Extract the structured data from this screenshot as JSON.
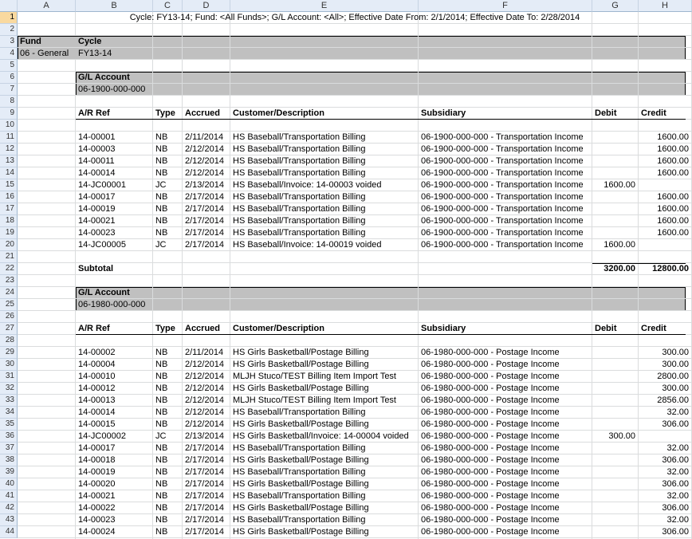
{
  "columns": [
    "A",
    "B",
    "C",
    "D",
    "E",
    "F",
    "G",
    "H"
  ],
  "title": "Cycle: FY13-14; Fund: <All Funds>; G/L Account: <All>; Effective Date From: 2/1/2014; Effective Date To: 2/28/2014",
  "fund_header": {
    "fund_label": "Fund",
    "cycle_label": "Cycle",
    "fund_value": "06 - General",
    "cycle_value": "FY13-14"
  },
  "section1": {
    "gl_label": "G/L Account",
    "gl_value": "06-1900-000-000",
    "headers": {
      "ar": "A/R Ref",
      "type": "Type",
      "accrued": "Accrued",
      "desc": "Customer/Description",
      "sub": "Subsidiary",
      "debit": "Debit",
      "credit": "Credit"
    },
    "rows": [
      {
        "ar": "14-00001",
        "type": "NB",
        "accrued": "2/11/2014",
        "desc": "HS Baseball/Transportation Billing",
        "sub": "06-1900-000-000 - Transportation Income",
        "debit": "",
        "credit": "1600.00"
      },
      {
        "ar": "14-00003",
        "type": "NB",
        "accrued": "2/12/2014",
        "desc": "HS Baseball/Transportation Billing",
        "sub": "06-1900-000-000 - Transportation Income",
        "debit": "",
        "credit": "1600.00"
      },
      {
        "ar": "14-00011",
        "type": "NB",
        "accrued": "2/12/2014",
        "desc": "HS Baseball/Transportation Billing",
        "sub": "06-1900-000-000 - Transportation Income",
        "debit": "",
        "credit": "1600.00"
      },
      {
        "ar": "14-00014",
        "type": "NB",
        "accrued": "2/12/2014",
        "desc": "HS Baseball/Transportation Billing",
        "sub": "06-1900-000-000 - Transportation Income",
        "debit": "",
        "credit": "1600.00"
      },
      {
        "ar": "14-JC00001",
        "type": "JC",
        "accrued": "2/13/2014",
        "desc": "HS Baseball/Invoice: 14-00003 voided",
        "sub": "06-1900-000-000 - Transportation Income",
        "debit": "1600.00",
        "credit": ""
      },
      {
        "ar": "14-00017",
        "type": "NB",
        "accrued": "2/17/2014",
        "desc": "HS Baseball/Transportation Billing",
        "sub": "06-1900-000-000 - Transportation Income",
        "debit": "",
        "credit": "1600.00"
      },
      {
        "ar": "14-00019",
        "type": "NB",
        "accrued": "2/17/2014",
        "desc": "HS Baseball/Transportation Billing",
        "sub": "06-1900-000-000 - Transportation Income",
        "debit": "",
        "credit": "1600.00"
      },
      {
        "ar": "14-00021",
        "type": "NB",
        "accrued": "2/17/2014",
        "desc": "HS Baseball/Transportation Billing",
        "sub": "06-1900-000-000 - Transportation Income",
        "debit": "",
        "credit": "1600.00"
      },
      {
        "ar": "14-00023",
        "type": "NB",
        "accrued": "2/17/2014",
        "desc": "HS Baseball/Transportation Billing",
        "sub": "06-1900-000-000 - Transportation Income",
        "debit": "",
        "credit": "1600.00"
      },
      {
        "ar": "14-JC00005",
        "type": "JC",
        "accrued": "2/17/2014",
        "desc": "HS Baseball/Invoice: 14-00019 voided",
        "sub": "06-1900-000-000 - Transportation Income",
        "debit": "1600.00",
        "credit": ""
      }
    ],
    "subtotal_label": "Subtotal",
    "subtotal_debit": "3200.00",
    "subtotal_credit": "12800.00"
  },
  "section2": {
    "gl_label": "G/L Account",
    "gl_value": "06-1980-000-000",
    "headers": {
      "ar": "A/R Ref",
      "type": "Type",
      "accrued": "Accrued",
      "desc": "Customer/Description",
      "sub": "Subsidiary",
      "debit": "Debit",
      "credit": "Credit"
    },
    "rows": [
      {
        "ar": "14-00002",
        "type": "NB",
        "accrued": "2/11/2014",
        "desc": "HS Girls Basketball/Postage Billing",
        "sub": "06-1980-000-000 - Postage Income",
        "debit": "",
        "credit": "300.00"
      },
      {
        "ar": "14-00004",
        "type": "NB",
        "accrued": "2/12/2014",
        "desc": "HS Girls Basketball/Postage Billing",
        "sub": "06-1980-000-000 - Postage Income",
        "debit": "",
        "credit": "300.00"
      },
      {
        "ar": "14-00010",
        "type": "NB",
        "accrued": "2/12/2014",
        "desc": "MLJH Stuco/TEST Billing Item Import Test",
        "sub": "06-1980-000-000 - Postage Income",
        "debit": "",
        "credit": "2800.00"
      },
      {
        "ar": "14-00012",
        "type": "NB",
        "accrued": "2/12/2014",
        "desc": "HS Girls Basketball/Postage Billing",
        "sub": "06-1980-000-000 - Postage Income",
        "debit": "",
        "credit": "300.00"
      },
      {
        "ar": "14-00013",
        "type": "NB",
        "accrued": "2/12/2014",
        "desc": "MLJH Stuco/TEST Billing Item Import Test",
        "sub": "06-1980-000-000 - Postage Income",
        "debit": "",
        "credit": "2856.00"
      },
      {
        "ar": "14-00014",
        "type": "NB",
        "accrued": "2/12/2014",
        "desc": "HS Baseball/Transportation Billing",
        "sub": "06-1980-000-000 - Postage Income",
        "debit": "",
        "credit": "32.00"
      },
      {
        "ar": "14-00015",
        "type": "NB",
        "accrued": "2/12/2014",
        "desc": "HS Girls Basketball/Postage Billing",
        "sub": "06-1980-000-000 - Postage Income",
        "debit": "",
        "credit": "306.00"
      },
      {
        "ar": "14-JC00002",
        "type": "JC",
        "accrued": "2/13/2014",
        "desc": "HS Girls Basketball/Invoice: 14-00004 voided",
        "sub": "06-1980-000-000 - Postage Income",
        "debit": "300.00",
        "credit": ""
      },
      {
        "ar": "14-00017",
        "type": "NB",
        "accrued": "2/17/2014",
        "desc": "HS Baseball/Transportation Billing",
        "sub": "06-1980-000-000 - Postage Income",
        "debit": "",
        "credit": "32.00"
      },
      {
        "ar": "14-00018",
        "type": "NB",
        "accrued": "2/17/2014",
        "desc": "HS Girls Basketball/Postage Billing",
        "sub": "06-1980-000-000 - Postage Income",
        "debit": "",
        "credit": "306.00"
      },
      {
        "ar": "14-00019",
        "type": "NB",
        "accrued": "2/17/2014",
        "desc": "HS Baseball/Transportation Billing",
        "sub": "06-1980-000-000 - Postage Income",
        "debit": "",
        "credit": "32.00"
      },
      {
        "ar": "14-00020",
        "type": "NB",
        "accrued": "2/17/2014",
        "desc": "HS Girls Basketball/Postage Billing",
        "sub": "06-1980-000-000 - Postage Income",
        "debit": "",
        "credit": "306.00"
      },
      {
        "ar": "14-00021",
        "type": "NB",
        "accrued": "2/17/2014",
        "desc": "HS Baseball/Transportation Billing",
        "sub": "06-1980-000-000 - Postage Income",
        "debit": "",
        "credit": "32.00"
      },
      {
        "ar": "14-00022",
        "type": "NB",
        "accrued": "2/17/2014",
        "desc": "HS Girls Basketball/Postage Billing",
        "sub": "06-1980-000-000 - Postage Income",
        "debit": "",
        "credit": "306.00"
      },
      {
        "ar": "14-00023",
        "type": "NB",
        "accrued": "2/17/2014",
        "desc": "HS Baseball/Transportation Billing",
        "sub": "06-1980-000-000 - Postage Income",
        "debit": "",
        "credit": "32.00"
      },
      {
        "ar": "14-00024",
        "type": "NB",
        "accrued": "2/17/2014",
        "desc": "HS Girls Basketball/Postage Billing",
        "sub": "06-1980-000-000 - Postage Income",
        "debit": "",
        "credit": "306.00"
      }
    ]
  }
}
